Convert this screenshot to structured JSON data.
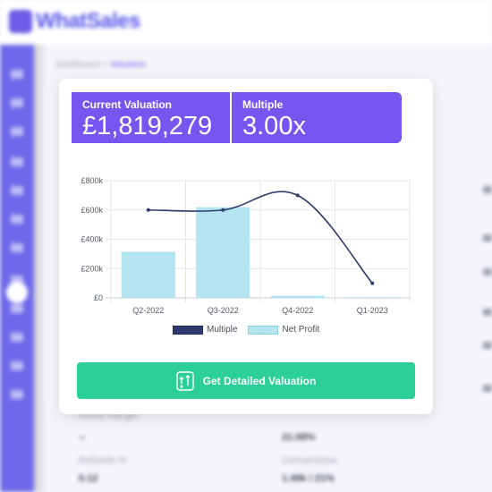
{
  "app": {
    "logo_text": "WhatSales",
    "brand_color": "#6c5ce7",
    "sidebar_color": "#6f69ea"
  },
  "breadcrumb": {
    "home": "Dashboard",
    "separator": ">",
    "current": "Valuation"
  },
  "stats": {
    "current_valuation_title": "Current Valuation",
    "current_valuation_value": "£1,819,279",
    "multiple_title": "Multiple",
    "multiple_value": "3.00x",
    "panel_color": "#7456f0"
  },
  "background_metrics": [
    {
      "label": "Gross margin",
      "value": "--"
    },
    {
      "label": "",
      "value": "21.08%"
    },
    {
      "label": "Refunds %",
      "value": "0.12"
    },
    {
      "label": "Conversions",
      "value": "1.49k / 21%"
    }
  ],
  "chart_data": {
    "type": "bar",
    "categories": [
      "Q2-2022",
      "Q3-2022",
      "Q4-2022",
      "Q1-2023"
    ],
    "y_ticks": [
      "£0",
      "£200k",
      "£400k",
      "£600k",
      "£800k"
    ],
    "ylim": [
      0,
      800000
    ],
    "series": [
      {
        "name": "Net Profit",
        "type": "bar",
        "values": [
          315000,
          620000,
          15000,
          5000
        ],
        "color": "#b3e5f0"
      },
      {
        "name": "Multiple",
        "type": "line",
        "values": [
          600000,
          600000,
          700000,
          100000
        ],
        "color": "#2e3a6e"
      }
    ],
    "legend_position": "bottom",
    "grid": true
  },
  "cta": {
    "label": "Get Detailed Valuation",
    "icon": "money-growth-icon",
    "color": "#2ccf97"
  }
}
